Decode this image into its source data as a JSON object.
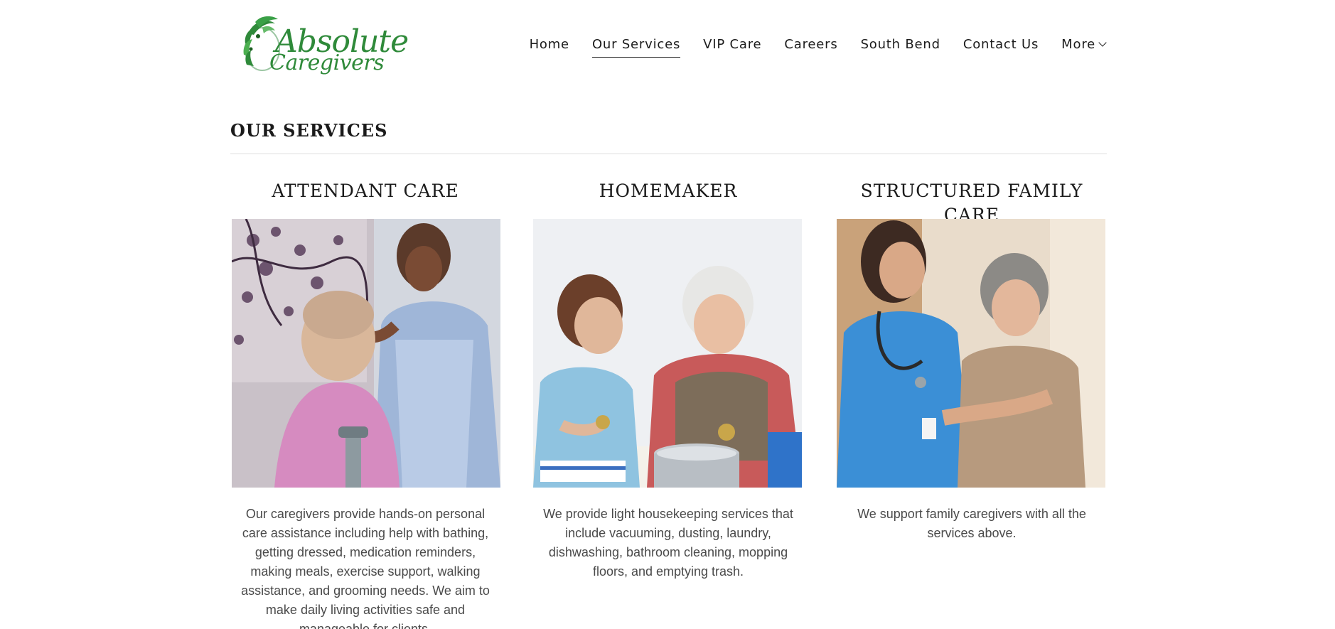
{
  "header": {
    "logo": {
      "line1": "Absolute",
      "line2": "Caregivers"
    },
    "nav": [
      {
        "label": "Home",
        "active": false
      },
      {
        "label": "Our Services",
        "active": true
      },
      {
        "label": "VIP Care",
        "active": false
      },
      {
        "label": "Careers",
        "active": false
      },
      {
        "label": "South Bend",
        "active": false
      },
      {
        "label": "Contact Us",
        "active": false
      },
      {
        "label": "More",
        "active": false,
        "icon": "chevron-down-icon"
      }
    ]
  },
  "main": {
    "title": "OUR SERVICES",
    "services": [
      {
        "title": "ATTENDANT CARE",
        "image": "caregiver brushing elderly woman's hair",
        "description": "Our caregivers provide hands-on personal care assistance including help with bathing, getting dressed, medication reminders, making meals, exercise support, walking assistance, and grooming needs. We aim to make daily living activities safe and manageable for clients."
      },
      {
        "title": "HOMEMAKER",
        "image": "caregiver peeling potatoes with elderly man",
        "description": "We provide light housekeeping services that include vacuuming, dusting, laundry, dishwashing, bathroom cleaning, mopping floors, and emptying trash."
      },
      {
        "title": "STRUCTURED FAMILY CARE",
        "image": "nurse embracing elderly woman",
        "description": "We support family caregivers with all the services above."
      }
    ]
  },
  "colors": {
    "brand_green": "#2f8a3a",
    "text": "#1b1b1b",
    "body_text": "#4a4a4a",
    "rule": "#dedede"
  }
}
